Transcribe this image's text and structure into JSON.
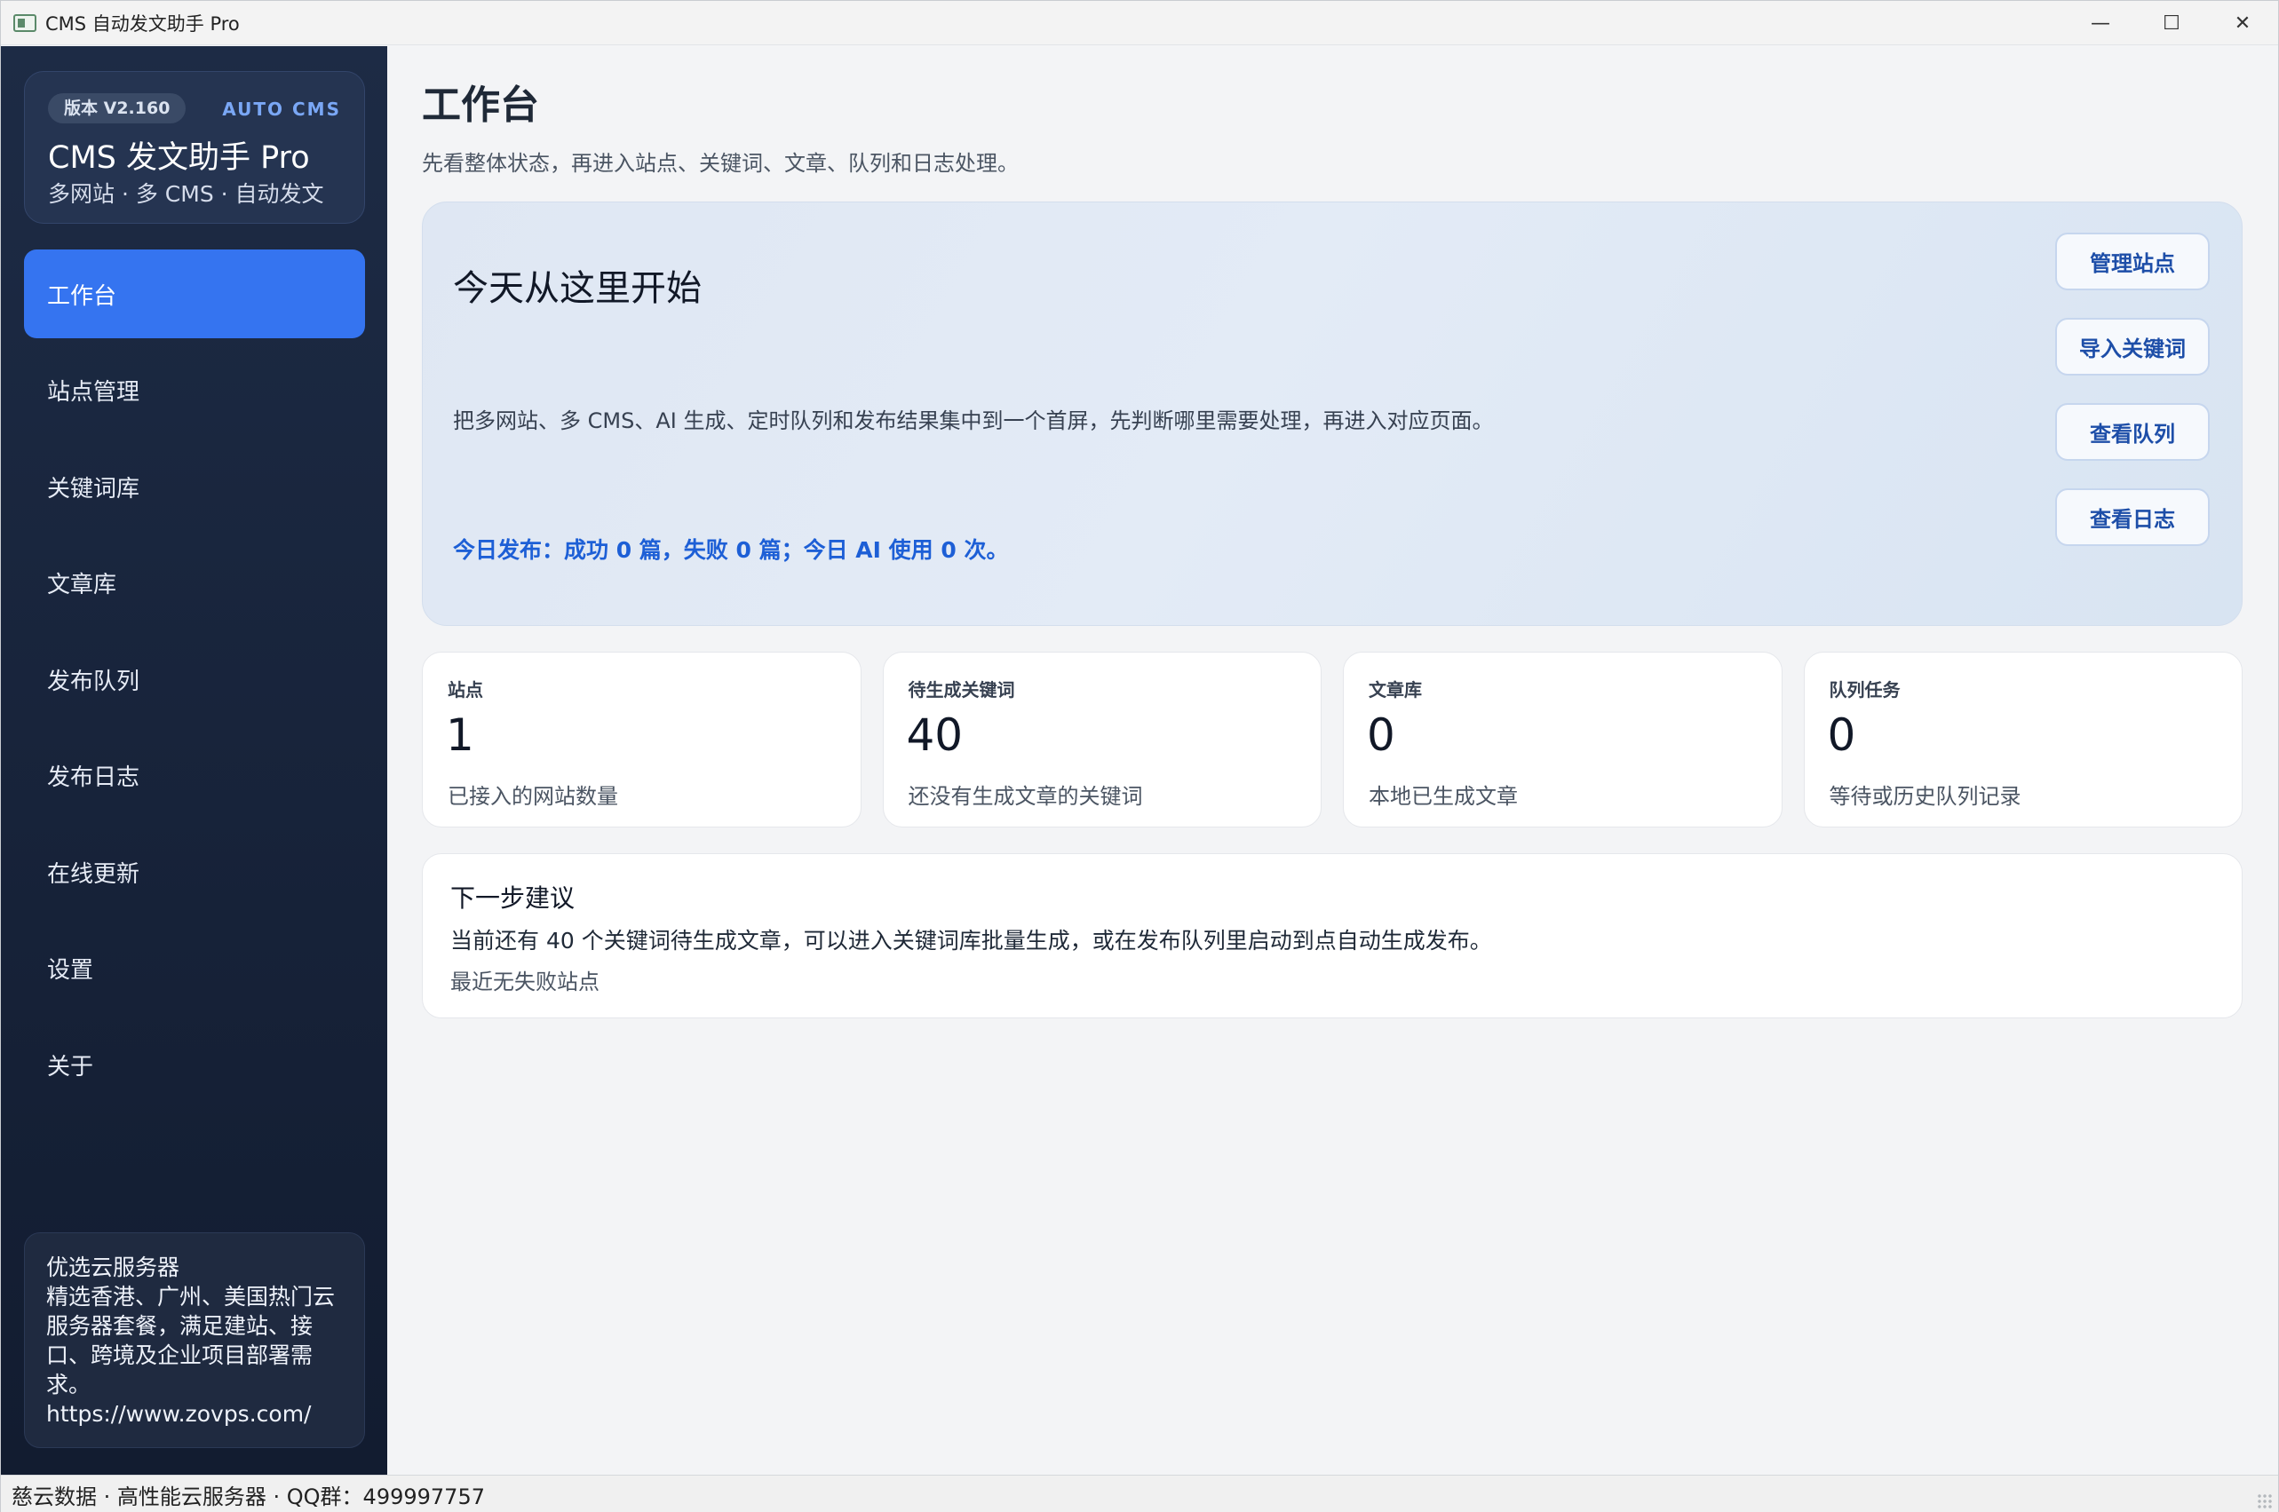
{
  "window": {
    "title": "CMS 自动发文助手 Pro",
    "controls": {
      "minimize": "—",
      "maximize": "☐",
      "close": "✕"
    }
  },
  "sidebar": {
    "version": "版本 V2.160",
    "tag": "AUTO CMS",
    "app_name": "CMS 发文助手 Pro",
    "tagline": "多网站 · 多 CMS · 自动发文",
    "nav": [
      {
        "label": "工作台",
        "active": true
      },
      {
        "label": "站点管理"
      },
      {
        "label": "关键词库"
      },
      {
        "label": "文章库"
      },
      {
        "label": "发布队列"
      },
      {
        "label": "发布日志"
      },
      {
        "label": "在线更新"
      },
      {
        "label": "设置"
      },
      {
        "label": "关于"
      }
    ],
    "ad": {
      "title": "优选云服务器",
      "body": "精选香港、广州、美国热门云服务器套餐，满足建站、接口、跨境及企业项目部署需求。",
      "url": "https://www.zovps.com/"
    }
  },
  "main": {
    "title": "工作台",
    "subtitle": "先看整体状态，再进入站点、关键词、文章、队列和日志处理。",
    "hero": {
      "title": "今天从这里开始",
      "description": "把多网站、多 CMS、AI 生成、定时队列和发布结果集中到一个首屏，先判断哪里需要处理，再进入对应页面。",
      "status": "今日发布：成功 0 篇，失败 0 篇；今日 AI 使用 0 次。",
      "actions": [
        "管理站点",
        "导入关键词",
        "查看队列",
        "查看日志"
      ]
    },
    "stats": [
      {
        "label": "站点",
        "value": "1",
        "desc": "已接入的网站数量"
      },
      {
        "label": "待生成关键词",
        "value": "40",
        "desc": "还没有生成文章的关键词"
      },
      {
        "label": "文章库",
        "value": "0",
        "desc": "本地已生成文章"
      },
      {
        "label": "队列任务",
        "value": "0",
        "desc": "等待或历史队列记录"
      }
    ],
    "next": {
      "title": "下一步建议",
      "line": "当前还有 40 个关键词待生成文章，可以进入关键词库批量生成，或在发布队列里启动到点自动生成发布。",
      "footer": "最近无失败站点"
    }
  },
  "statusbar": {
    "text": "慈云数据 · 高性能云服务器 · QQ群：499997757"
  },
  "colors": {
    "accent": "#3574f0",
    "sidebar": "#1a2740",
    "link": "#1d5fd6"
  }
}
